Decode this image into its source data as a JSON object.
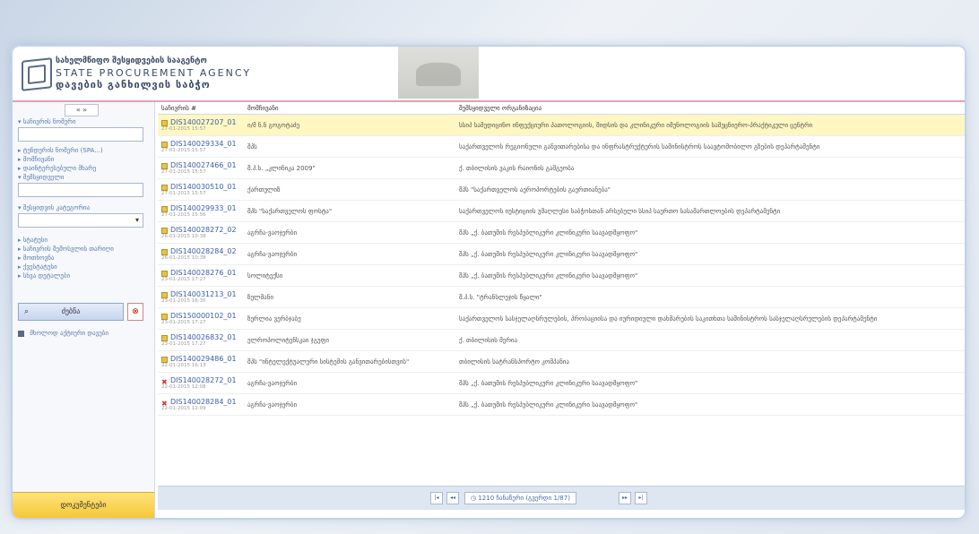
{
  "logo": {
    "line1": "სახელმწიფო შესყიდვების სააგენტო",
    "line2": "STATE PROCUREMENT AGENCY",
    "line3": "დავების განხილვის საბჭო"
  },
  "sidebar": {
    "collapse": "« »",
    "filters": [
      {
        "label": "▾ საჩივრის ნომერი"
      },
      {
        "label": "▾ შემსყიდველი"
      },
      {
        "label": "▾ შესყიდვის კატეგორია"
      }
    ],
    "links_a": [
      "▸ ტენდერის ნომერი (SPA...)",
      "▸ მომჩივანი",
      "▸ დაინტერესებული მხარე"
    ],
    "links_b": [
      "▸ სტატუსი",
      "▸ საჩივრის შემოსვლის თარიღი",
      "▸ მოთხოვნა",
      "▸ ქვესტატუსი",
      "▸ სხვა დეტალები"
    ],
    "category_value": "▾",
    "search_icon": "⌕",
    "search_label": "ძებნა",
    "clear_icon": "⊗",
    "checkbox_label": "მხოლოდ აქტიური დავები",
    "footer": "დოკუმენტები"
  },
  "table": {
    "headers": [
      "საჩივრის #",
      "მომჩივანი",
      "შემსყიდველი ორგანიზაცია"
    ],
    "rows": [
      {
        "id": "DIS140027207_01",
        "date": "27-01-2015 15:57",
        "status": "ok",
        "complainant": "ი/მ ნ.ნ გოგოტაძე",
        "org": "სსიპ სამედიცინო ინფექციური პათოლოგიის, შიდსის და კლინიკური იმუნოლოგიის სამეცნიერო-პრაქტიკული ცენტრი",
        "hl": true
      },
      {
        "id": "DIS140029334_01",
        "date": "27-01-2015 15:57",
        "status": "ok",
        "complainant": "შპს",
        "org": "საქართველოს რეგიონული განვითარებისა და ინფრასტრუქტურის სამინისტროს საავტომობილო გზების დეპარტამენტი",
        "hl": false
      },
      {
        "id": "DIS140027466_01",
        "date": "27-01-2015 15:57",
        "status": "ok",
        "complainant": "შ.პ.ს. „კლინიკა 2009\"",
        "org": "ქ. თბილისის ვაკის რაიონის გამგეობა",
        "hl": false
      },
      {
        "id": "DIS140030510_01",
        "date": "27-01-2015 15:57",
        "status": "ok",
        "complainant": "ქართულიზ",
        "org": "შპს \"საქართველოს აეროპორტების გაერთიანება\"",
        "hl": false
      },
      {
        "id": "DIS140029933_01",
        "date": "27-01-2015 15:56",
        "status": "ok",
        "complainant": "შპს \"საქართველოს ფოსტა\"",
        "org": "საქართველოს იუსტიციის უმაღლესი საბჭოსთან არსებული სსიპ საერთო სასამართლოების დეპარტამენტი",
        "hl": false
      },
      {
        "id": "DIS140028272_02",
        "date": "26-01-2015 10:38",
        "status": "ok",
        "complainant": "აგრჩა-ვაოჯერბი",
        "org": "შპს „ქ. ბათუმის რესპუბლიკური კლინიკური საავადმყოფო\"",
        "hl": false
      },
      {
        "id": "DIS140028284_02",
        "date": "26-01-2015 10:38",
        "status": "ok",
        "complainant": "აგრჩა-ვაოჯერბი",
        "org": "შპს „ქ. ბათუმის რესპუბლიკური კლინიკური საავადმყოფო\"",
        "hl": false
      },
      {
        "id": "DIS140028276_01",
        "date": "23-01-2015 17:27",
        "status": "ok",
        "complainant": "სოლიტექსი",
        "org": "შპს „ქ. ბათუმის რესპუბლიკური კლინიკური საავადმყოფო\"",
        "hl": false
      },
      {
        "id": "DIS140031213_01",
        "date": "23-01-2015 16:35",
        "status": "ok",
        "complainant": "ზელმანი",
        "org": "შ.პ.ს. \"ტრანსლეჯის წყალი\"",
        "hl": false
      },
      {
        "id": "DIS150000102_01",
        "date": "23-01-2015 17:27",
        "status": "ok",
        "complainant": "ზერლია ვერბჯაბე",
        "org": "საქართველოს სასჯელაღსრულების, პრობაციისა და იურიდიული დახმარების საკითხთა სამინისტროს სასჯელაღსრულების დეპარტამენტი",
        "hl": false
      },
      {
        "id": "DIS140026832_01",
        "date": "23-01-2015 17:27",
        "status": "ok",
        "complainant": "ელროპოლიტენსკაი ჯგუფი",
        "org": "ქ. თბილისის მერია",
        "hl": false
      },
      {
        "id": "DIS140029486_01",
        "date": "22-01-2015 16:13",
        "status": "ok",
        "complainant": "შპს \"ინტელექტუალური სისტემის განვითარებისთვის\"",
        "org": "თბილისის სატრანსპორტო კომპანია",
        "hl": false
      },
      {
        "id": "DIS140028272_01",
        "date": "22-01-2015 12:08",
        "status": "x",
        "complainant": "აგრჩა-ვაოჯერბი",
        "org": "შპს „ქ. ბათუმის რესპუბლიკური კლინიკური საავადმყოფო\"",
        "hl": false
      },
      {
        "id": "DIS140028284_01",
        "date": "22-01-2015 12:09",
        "status": "x",
        "complainant": "აგრჩა-ვაოჯერბი",
        "org": "შპს „ქ. ბათუმის რესპუბლიკური კლინიკური საავადმყოფო\"",
        "hl": false
      }
    ]
  },
  "pager": {
    "first": "|◂",
    "prev": "◂◂",
    "text": "◷ 1210 ჩანაწერი (გვერდი 1/87)",
    "next": "▸▸",
    "last": "▸|"
  }
}
